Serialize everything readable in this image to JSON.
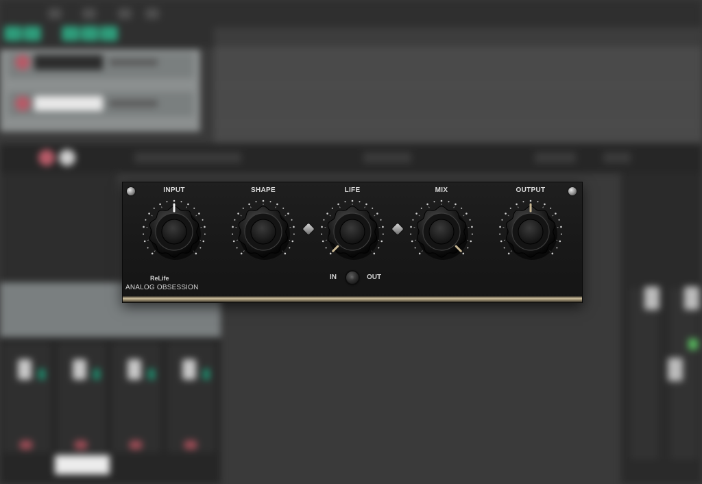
{
  "plugin": {
    "brand": "ANALOG OBSESSION",
    "model": "ReLife",
    "knobs": [
      {
        "id": "input",
        "label": "INPUT",
        "value": 0.5,
        "marker": "white"
      },
      {
        "id": "shape",
        "label": "SHAPE",
        "value": 0.0,
        "marker": "none"
      },
      {
        "id": "life",
        "label": "LIFE",
        "value": 0.0,
        "marker": "tan"
      },
      {
        "id": "mix",
        "label": "MIX",
        "value": 1.0,
        "marker": "tan"
      },
      {
        "id": "output",
        "label": "OUTPUT",
        "value": 0.5,
        "marker": "tan"
      }
    ],
    "switch": {
      "left_label": "IN",
      "right_label": "OUT"
    },
    "colors": {
      "panel": "#181818",
      "label": "#dcdcdc",
      "trim": "#cbbd9d"
    }
  },
  "background": {
    "daw_colors": {
      "record_arm": "#2e9c7a",
      "track_arm": "#b65a67",
      "meter_green": "#57b85e"
    }
  }
}
